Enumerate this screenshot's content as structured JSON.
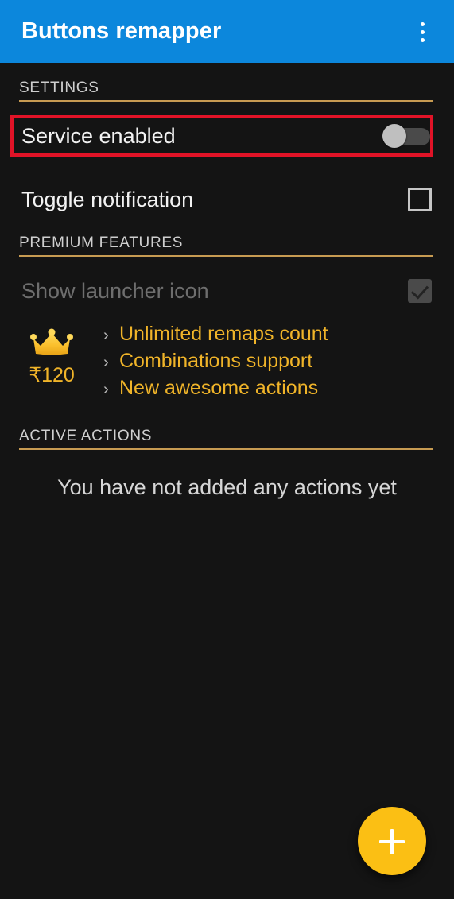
{
  "appbar": {
    "title": "Buttons remapper",
    "overflow_icon": "more-vert-icon",
    "background_color": "#0C87DC",
    "title_color": "#FFFFFF"
  },
  "sections": {
    "settings": {
      "header": "SETTINGS",
      "rule_color": "#C79B52",
      "rows": [
        {
          "title": "Service enabled",
          "control": "switch",
          "control_state": "off",
          "disabled": false
        },
        {
          "title": "Toggle notification",
          "control": "checkbox",
          "control_state": "unchecked",
          "disabled": false
        }
      ]
    },
    "premium": {
      "header": "PREMIUM FEATURES",
      "rule_color": "#C79B52",
      "rows": [
        {
          "title": "Show launcher icon",
          "control": "checkbox",
          "control_state": "checked",
          "disabled": true
        }
      ],
      "badge": {
        "icon": "crown-icon",
        "price": "₹120",
        "price_color": "#F0B429"
      },
      "features": [
        {
          "chevron": "›",
          "label": "Unlimited remaps count"
        },
        {
          "chevron": "›",
          "label": "Combinations support"
        },
        {
          "chevron": "›",
          "label": "New awesome actions"
        }
      ]
    },
    "active_actions": {
      "header": "ACTIVE ACTIONS",
      "rule_color": "#C79B52",
      "empty_message": "You have not added any actions yet"
    }
  },
  "fab": {
    "icon": "plus-icon",
    "color": "#FBBF14"
  },
  "annotation": {
    "type": "highlight-rectangle",
    "color": "#E01327",
    "target": "Service enabled"
  }
}
